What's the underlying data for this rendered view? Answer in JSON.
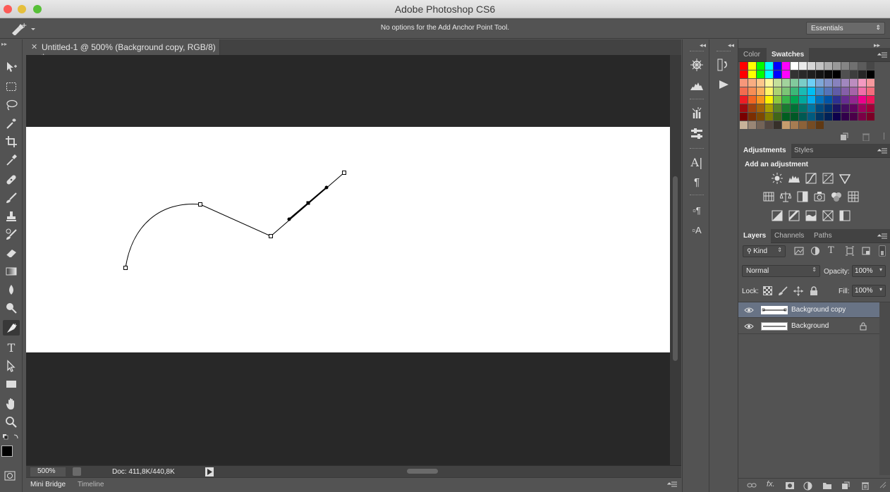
{
  "app": {
    "title": "Adobe Photoshop CS6"
  },
  "options_bar": {
    "message": "No options for the Add Anchor Point Tool.",
    "workspace": "Essentials"
  },
  "document": {
    "tab_title": "Untitled-1 @ 500% (Background copy, RGB/8) *",
    "zoom": "500%",
    "doc_info": "Doc: 411,8K/440,8K"
  },
  "bottom_tabs": [
    "Mini Bridge",
    "Timeline"
  ],
  "color_panel": {
    "tabs": [
      "Color",
      "Swatches"
    ],
    "active": "Swatches"
  },
  "swatch_rows": [
    [
      "#ff0000",
      "#ffff00",
      "#00ff00",
      "#00ffff",
      "#0000ff",
      "#ff00ff",
      "#ffffff",
      "#ebebeb",
      "#d6d6d6",
      "#c2c2c2",
      "#adadad",
      "#999999",
      "#858585",
      "#707070",
      "#5c5c5c",
      "#474747"
    ],
    [
      "#ff0000",
      "#ffff00",
      "#00ff00",
      "#00ffff",
      "#0000ff",
      "#ff00ff",
      "#333333",
      "#292929",
      "#1f1f1f",
      "#141414",
      "#0a0a0a",
      "#000000",
      "#505050",
      "#3d3d3d",
      "#262626",
      "#000000"
    ],
    [
      "#f7977a",
      "#f9ad81",
      "#fdc68a",
      "#fff79a",
      "#c4df9b",
      "#a2d39c",
      "#82ca9d",
      "#7bcdc8",
      "#6ecff6",
      "#7ea7d8",
      "#8493ca",
      "#8882be",
      "#a187be",
      "#bc8dbf",
      "#f49ac2",
      "#f6989d"
    ],
    [
      "#f26c4f",
      "#f68e55",
      "#fbaf5d",
      "#fff467",
      "#acd372",
      "#7cc576",
      "#3bb878",
      "#1abbb4",
      "#00bff3",
      "#438cca",
      "#5574b9",
      "#605ca8",
      "#855fa8",
      "#a763a8",
      "#f06ea9",
      "#f26d7d"
    ],
    [
      "#ed1c24",
      "#f26522",
      "#f7941d",
      "#fff200",
      "#8dc73f",
      "#39b54a",
      "#00a651",
      "#00a99d",
      "#00aeef",
      "#0072bc",
      "#0054a6",
      "#2e3192",
      "#662d91",
      "#92278f",
      "#ec008c",
      "#ed145b"
    ],
    [
      "#9e0b0f",
      "#a0410d",
      "#a36209",
      "#aba000",
      "#598527",
      "#1a7b30",
      "#007236",
      "#00746b",
      "#0076a3",
      "#004b80",
      "#003471",
      "#1b1464",
      "#440e62",
      "#630460",
      "#9e005d",
      "#9e0039"
    ],
    [
      "#790000",
      "#7b2e00",
      "#7d4900",
      "#827b00",
      "#406618",
      "#005e20",
      "#005826",
      "#005952",
      "#005b7f",
      "#003663",
      "#002157",
      "#0d004c",
      "#32004b",
      "#4b0049",
      "#7b0046",
      "#7a0026"
    ],
    [
      "#c7b299",
      "#998675",
      "#736357",
      "#534741",
      "#37302a",
      "#c69c6d",
      "#a67c52",
      "#8c6239",
      "#754c24",
      "#603913"
    ]
  ],
  "adjustments_panel": {
    "tabs": [
      "Adjustments",
      "Styles"
    ],
    "active": "Adjustments",
    "header": "Add an adjustment"
  },
  "layers_panel": {
    "tabs": [
      "Layers",
      "Channels",
      "Paths"
    ],
    "active": "Layers",
    "filter": "Kind",
    "blend_mode": "Normal",
    "opacity_label": "Opacity:",
    "opacity": "100%",
    "lock_label": "Lock:",
    "fill_label": "Fill:",
    "fill": "100%",
    "layers": [
      {
        "name": "Background copy",
        "selected": true,
        "locked": false
      },
      {
        "name": "Background",
        "selected": false,
        "locked": true
      }
    ]
  }
}
